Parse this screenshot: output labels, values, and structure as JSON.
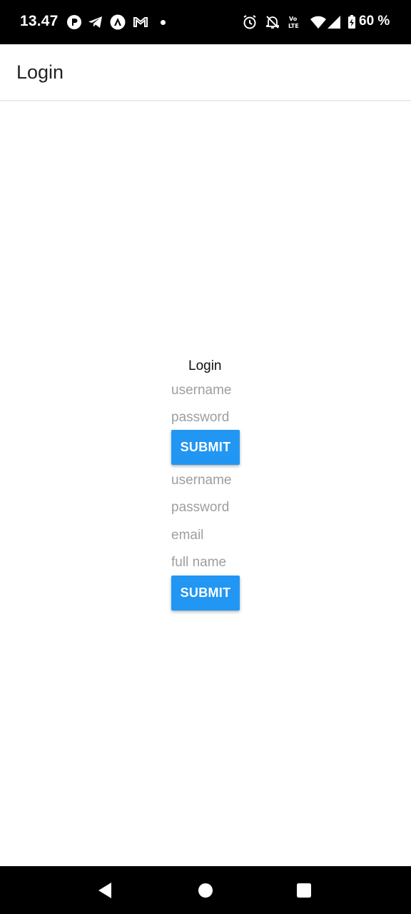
{
  "status_bar": {
    "time": "13.47",
    "battery_percent": "60 %",
    "network_label": "Vo LTE",
    "notification_icons": [
      "app-p-icon",
      "telegram-icon",
      "app-a-icon",
      "gmail-icon",
      "dot-icon"
    ],
    "system_icons": [
      "alarm-icon",
      "notifications-off-icon",
      "volte-icon",
      "wifi-icon",
      "signal-icon",
      "battery-icon"
    ]
  },
  "app_bar": {
    "title": "Login"
  },
  "login_form": {
    "heading": "Login",
    "username_placeholder": "username",
    "password_placeholder": "password",
    "submit_label": "SUBMIT"
  },
  "register_form": {
    "username_placeholder": "username",
    "password_placeholder": "password",
    "email_placeholder": "email",
    "fullname_placeholder": "full name",
    "submit_label": "SUBMIT"
  },
  "nav_bar": {
    "buttons": [
      "back",
      "home",
      "recents"
    ]
  },
  "colors": {
    "accent": "#2196f3",
    "status_bar": "#000000",
    "placeholder": "#9e9e9e"
  }
}
